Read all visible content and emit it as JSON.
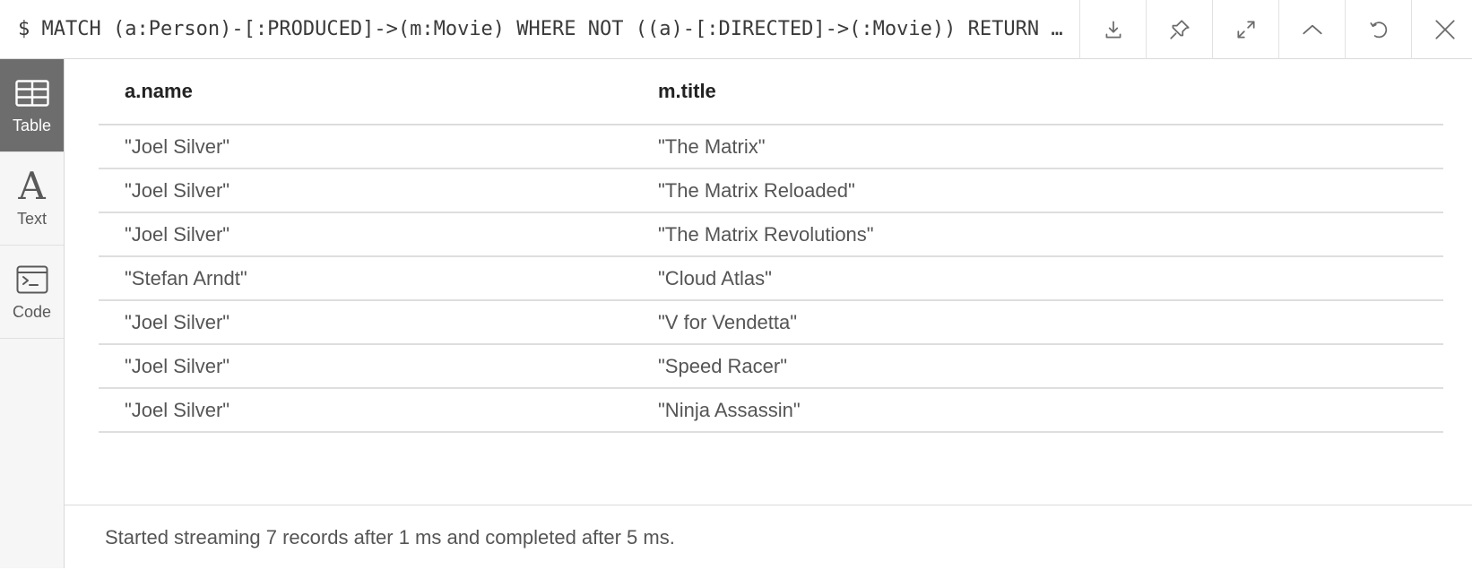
{
  "query": "$ MATCH (a:Person)-[:PRODUCED]->(m:Movie) WHERE NOT ((a)-[:DIRECTED]->(:Movie)) RETURN a.name, m.title",
  "toolbar": {
    "icons": [
      "download-icon",
      "pin-icon",
      "expand-icon",
      "collapse-up-icon",
      "rerun-icon",
      "close-icon"
    ]
  },
  "sidebar": {
    "items": [
      {
        "label": "Table",
        "icon": "table-icon",
        "active": true
      },
      {
        "label": "Text",
        "icon": "text-icon",
        "active": false
      },
      {
        "label": "Code",
        "icon": "code-icon",
        "active": false
      }
    ]
  },
  "table": {
    "headers": [
      "a.name",
      "m.title"
    ],
    "rows": [
      [
        "\"Joel Silver\"",
        "\"The Matrix\""
      ],
      [
        "\"Joel Silver\"",
        "\"The Matrix Reloaded\""
      ],
      [
        "\"Joel Silver\"",
        "\"The Matrix Revolutions\""
      ],
      [
        "\"Stefan Arndt\"",
        "\"Cloud Atlas\""
      ],
      [
        "\"Joel Silver\"",
        "\"V for Vendetta\""
      ],
      [
        "\"Joel Silver\"",
        "\"Speed Racer\""
      ],
      [
        "\"Joel Silver\"",
        "\"Ninja Assassin\""
      ]
    ]
  },
  "status": "Started streaming 7 records after 1 ms and completed after 5 ms.",
  "colors": {
    "active_tab_bg": "#6d6d6d",
    "sidebar_bg": "#f6f6f6",
    "border": "#dadada"
  }
}
